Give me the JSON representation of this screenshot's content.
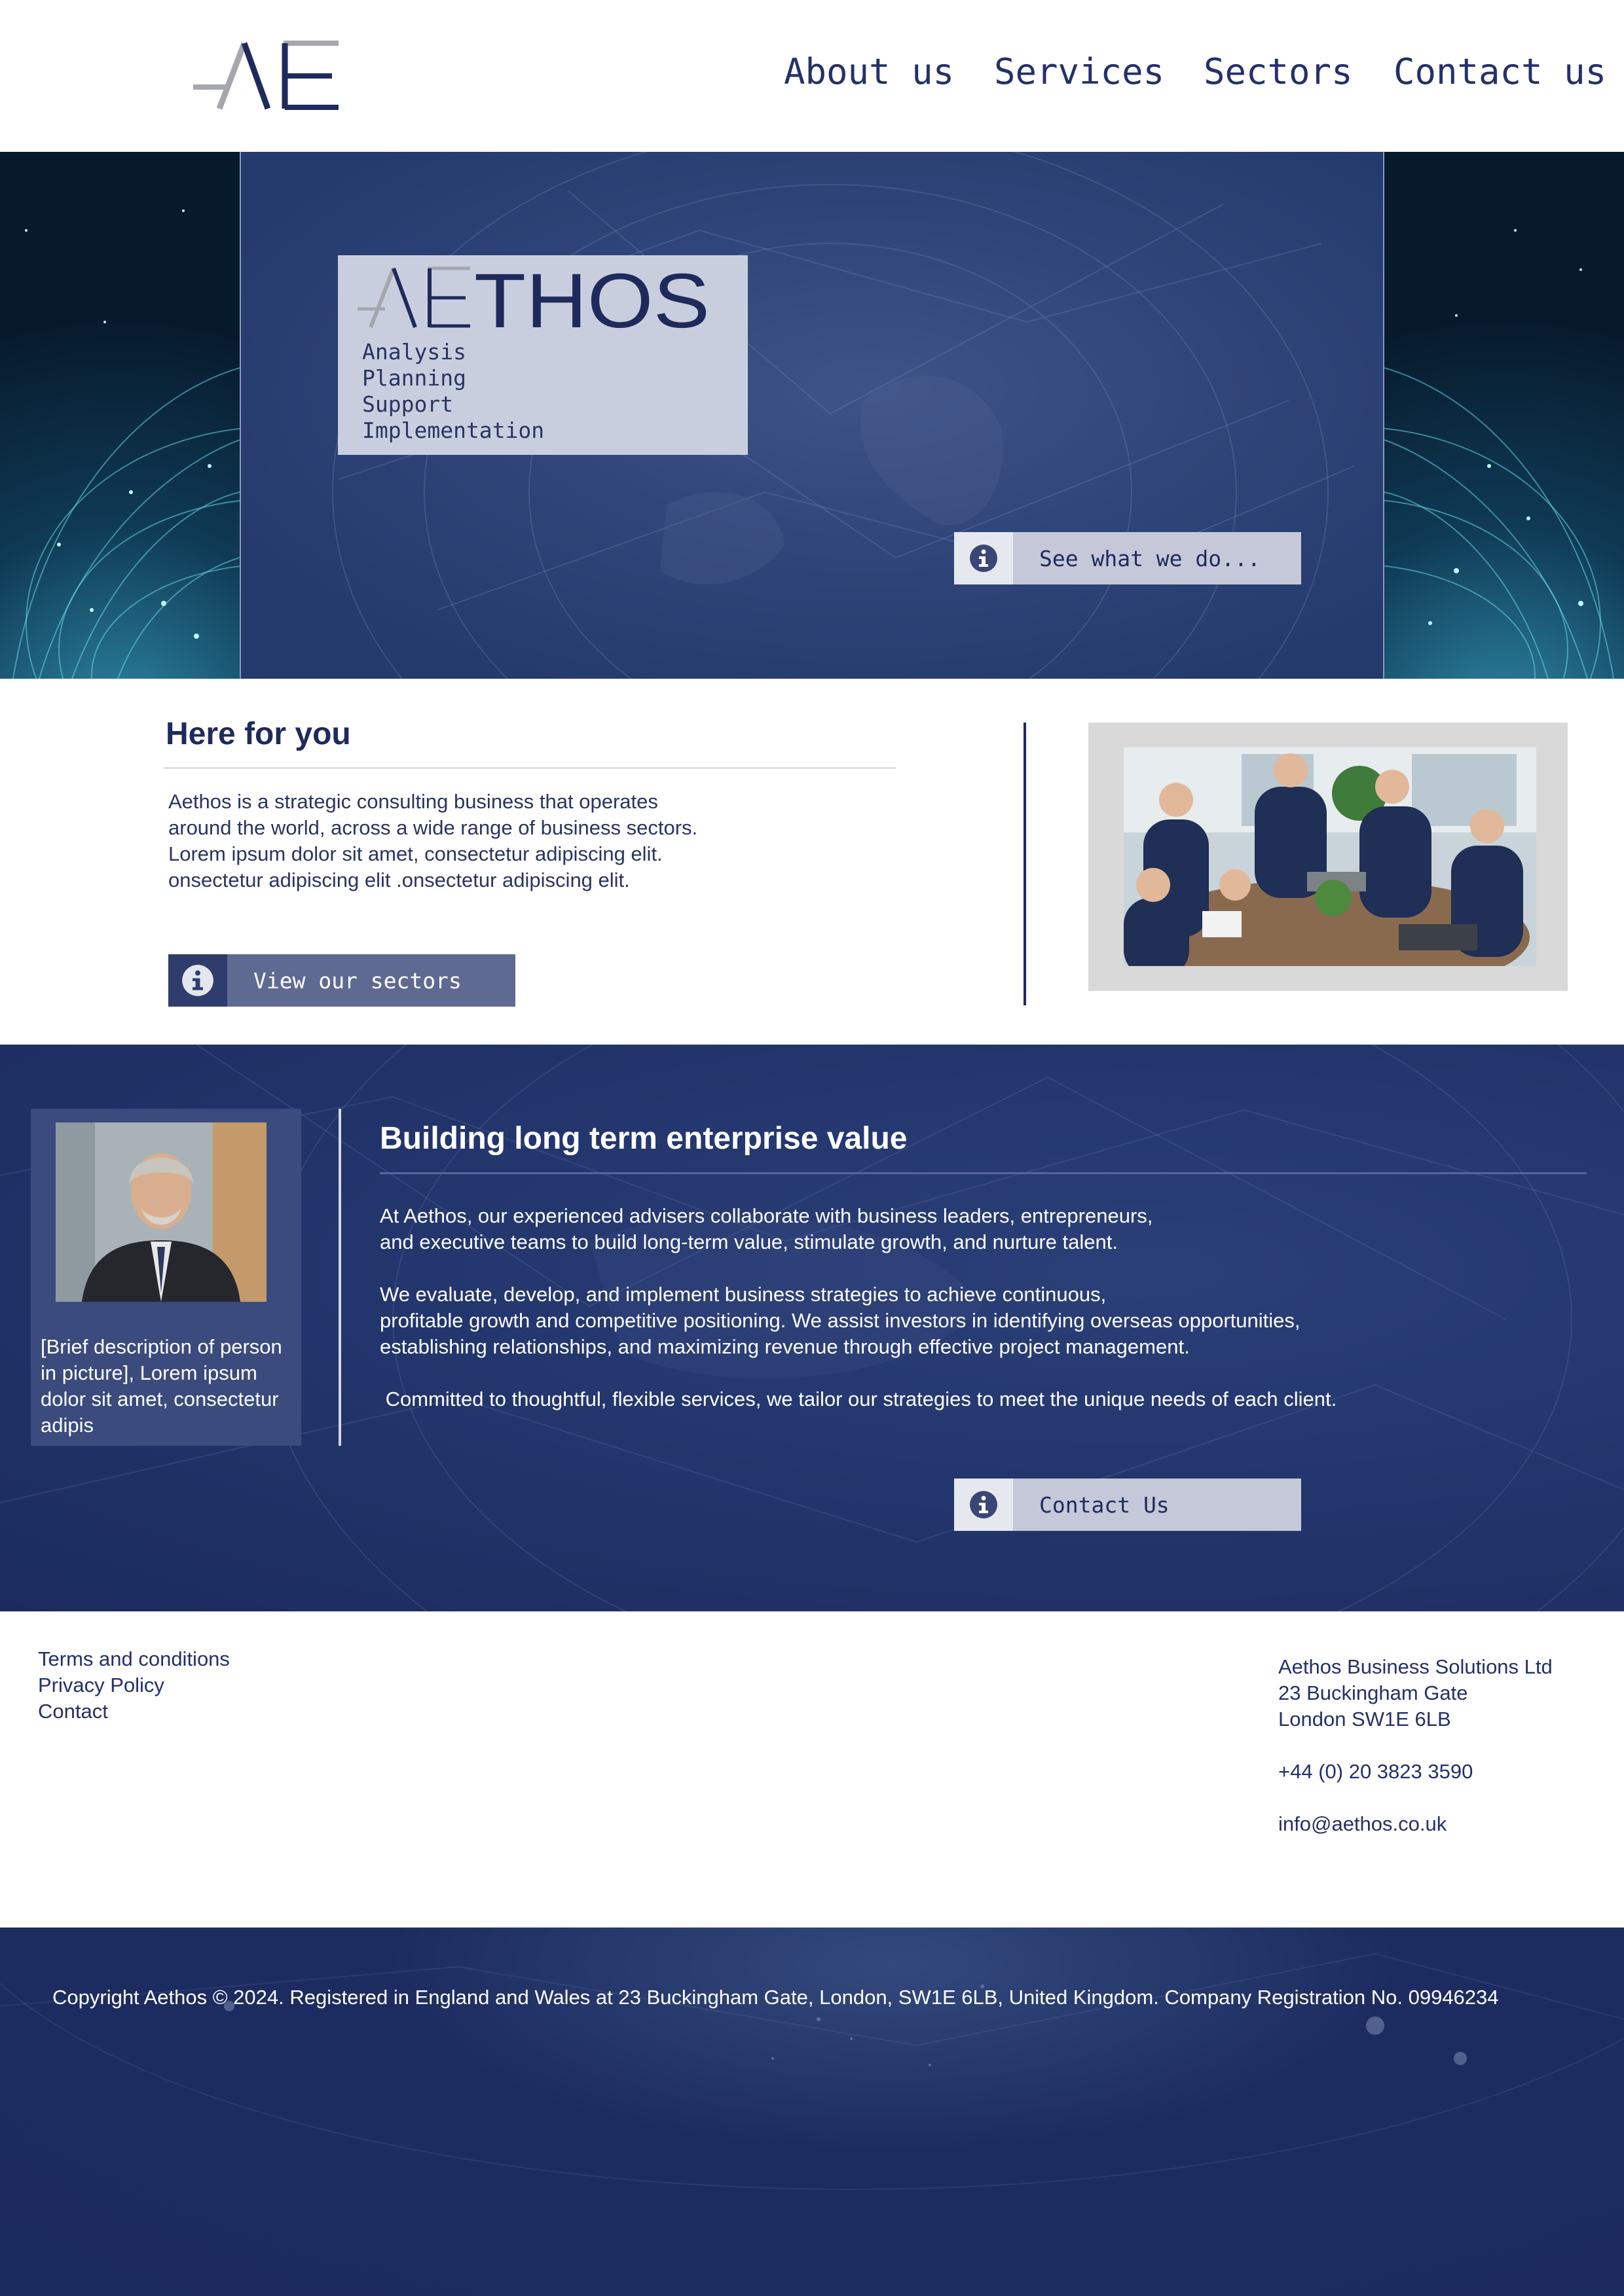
{
  "header": {
    "nav": [
      {
        "label": "About us"
      },
      {
        "label": "Services"
      },
      {
        "label": "Sectors"
      },
      {
        "label": "Contact us"
      }
    ]
  },
  "hero": {
    "brand_name": "AETHOS",
    "services": [
      "Analysis",
      "Planning",
      "Support",
      "Implementation"
    ],
    "cta_label": "See what we do...",
    "cta_icon": "info-icon"
  },
  "here_for_you": {
    "title": "Here for you",
    "lines": [
      "Aethos is a strategic consulting business that operates",
      "around the world, across a wide range of business sectors.",
      "Lorem ipsum dolor sit amet, consectetur adipiscing elit.",
      "onsectetur adipiscing elit .onsectetur adipiscing elit."
    ],
    "cta_label": "View our sectors",
    "cta_icon": "info-icon"
  },
  "enterprise_value": {
    "title": "Building long term enterprise value",
    "person_caption": "[Brief description of person in picture], Lorem ipsum dolor sit amet, consectetur adipis",
    "paragraph1": [
      "At Aethos, our experienced advisers collaborate with business leaders, entrepreneurs,",
      "and executive teams to build long-term value, stimulate growth, and nurture talent."
    ],
    "paragraph2": [
      "We evaluate, develop, and implement business strategies to achieve continuous,",
      "profitable growth and competitive positioning. We assist investors in identifying overseas opportunities,",
      "establishing relationships, and maximizing revenue through effective project management."
    ],
    "paragraph3": " Committed to thoughtful, flexible services, we tailor our strategies to meet the unique needs of each client.",
    "cta_label": "Contact Us",
    "cta_icon": "info-icon"
  },
  "footer": {
    "links": [
      "Terms and conditions",
      "Privacy Policy",
      "Contact"
    ],
    "company": "Aethos Business Solutions Ltd",
    "address_line1": "23 Buckingham Gate",
    "address_line2": "London SW1E 6LB",
    "phone": "+44 (0) 20 3823 3590",
    "email": "info@aethos.co.uk",
    "copyright": "Copyright Aethos © 2024. Registered in England and Wales at 23 Buckingham Gate, London, SW1E 6LB, United Kingdom. Company Registration No. 09946234"
  },
  "colors": {
    "navy": "#1f2a5c",
    "brand_blue": "#24306a",
    "light_card": "#c9cede",
    "button_muted": "#5f6a92"
  }
}
